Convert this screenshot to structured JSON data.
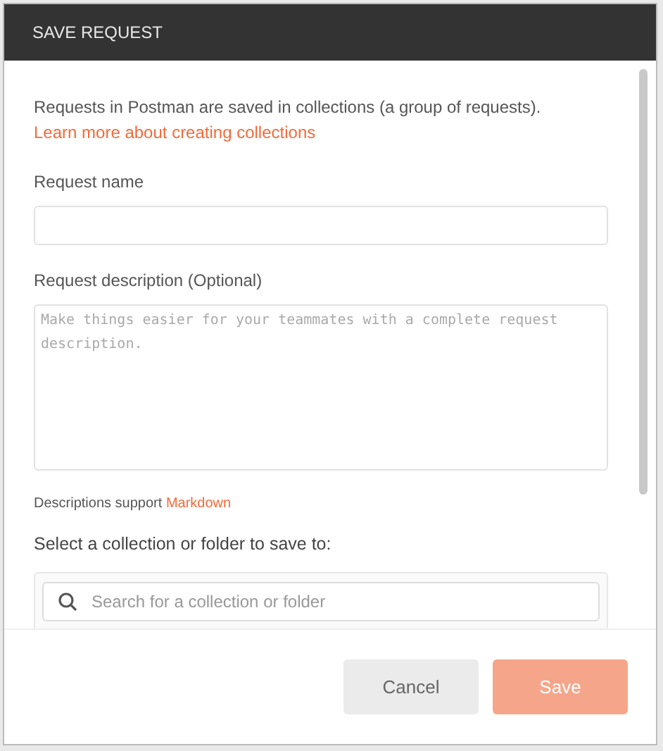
{
  "dialog": {
    "title": "SAVE REQUEST"
  },
  "intro": {
    "text": "Requests in Postman are saved in collections (a group of requests).",
    "link": "Learn more about creating collections"
  },
  "name_field": {
    "label": "Request name"
  },
  "description_field": {
    "label": "Request description (Optional)",
    "placeholder": "Make things easier for your teammates with a complete request description."
  },
  "markdown_note": {
    "text": "Descriptions support",
    "link": "Markdown"
  },
  "collection_picker": {
    "label": "Select a collection or folder to save to:",
    "search": {
      "placeholder": "Search for a collection or folder"
    }
  },
  "buttons": [
    {
      "label": "Cancel",
      "kind": "secondary",
      "disabled": false
    },
    {
      "label": "Save",
      "kind": "primary",
      "disabled": true
    }
  ]
}
